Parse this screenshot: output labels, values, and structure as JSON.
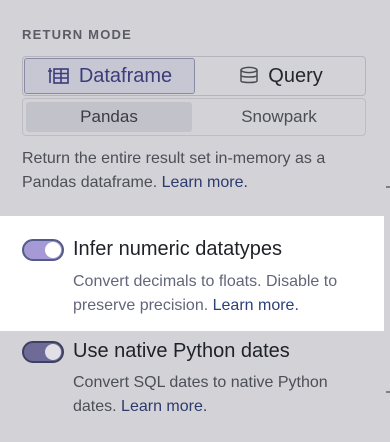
{
  "return_mode": {
    "section_label": "RETURN MODE",
    "primary_options": [
      {
        "label": "Dataframe",
        "icon": "dataframe-icon",
        "active": true
      },
      {
        "label": "Query",
        "icon": "database-icon",
        "active": false
      }
    ],
    "secondary_options": [
      {
        "label": "Pandas",
        "active": true
      },
      {
        "label": "Snowpark",
        "active": false
      }
    ],
    "description": "Return the entire result set in-memory as a Pandas dataframe.",
    "learn_more": "Learn more."
  },
  "toggles": [
    {
      "label": "Infer numeric datatypes",
      "description": "Convert decimals to floats. Disable to preserve precision.",
      "learn_more": "Learn more.",
      "enabled": true,
      "highlighted": true
    },
    {
      "label": "Use native Python dates",
      "description": "Convert SQL dates to native Python dates.",
      "learn_more": "Learn more.",
      "enabled": true,
      "highlighted": false
    }
  ],
  "colors": {
    "overlay": "#d2d2d7",
    "highlight": "#ffffff",
    "toggle_on": "#a59ad6",
    "link": "#2c3b6e"
  }
}
